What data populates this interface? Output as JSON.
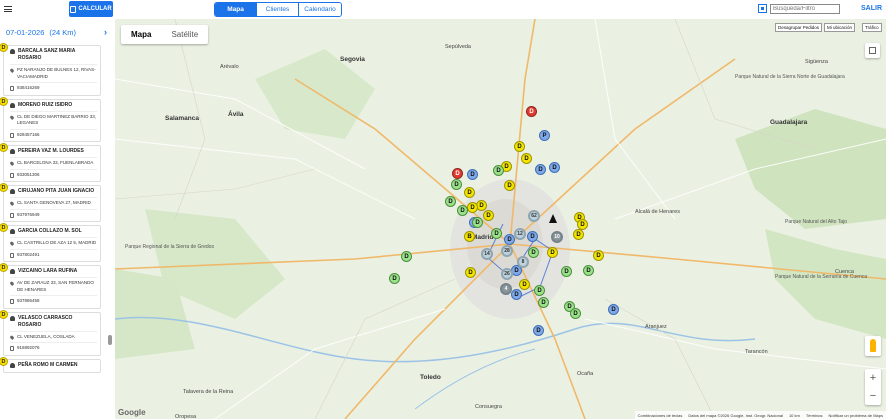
{
  "topbar": {
    "calc_label": "CALCULAR",
    "tabs": [
      "Mapa",
      "Clientes",
      "Calendario"
    ],
    "search_placeholder": "Búsqueda/Filtro",
    "logout_label": "SALIR"
  },
  "sidebar": {
    "date": "07-01-2026",
    "distance": "(24 Km)",
    "next_icon": "chevron-right-icon",
    "cards": [
      {
        "badge": "D",
        "name": "BARCALA SANZ MARIA ROSARIO",
        "address": "PZ NARANJO DE BULNES 12, RIVAS-VACIAMADRID",
        "phone": "938416269"
      },
      {
        "badge": "D",
        "name": "MORENO RUIZ ISIDRO",
        "address": "CL DE DIEGO MARTINEZ BARRIO 33, LEGANES",
        "phone": "928457166"
      },
      {
        "badge": "D",
        "name": "PEREIRA VAZ M. LOURDES",
        "address": "CL BARCELONA 33, FUENLABRADA",
        "phone": "933051306"
      },
      {
        "badge": "D",
        "name": "CIRUJANO PITA JUAN IGNACIO",
        "address": "CL SANTA GENOVEVA 27, MADRID",
        "phone": "937976949"
      },
      {
        "badge": "D",
        "name": "GARCIA COLLAZO M. SOL",
        "address": "CL CASTRILLO DE AZA 12 5, MADRID",
        "phone": "937802491"
      },
      {
        "badge": "D",
        "name": "VIZCAINO LARA RUFINA",
        "address": "AV DE ZARAUZ 33, SAN FERNANDO DE HENARES",
        "phone": "937886458"
      },
      {
        "badge": "D",
        "name": "VELASCO CARRASCO ROSARIO",
        "address": "CL VENEZUELA, COSLADA",
        "phone": "916892076"
      },
      {
        "badge": "D",
        "name": "PEÑA ROMO M CARMEN",
        "address": "",
        "phone": ""
      }
    ]
  },
  "map": {
    "types": [
      "Mapa",
      "Satélite"
    ],
    "buttons": [
      "Desagrupar Pedidos",
      "Mi ubicación",
      "Tráfico"
    ],
    "labels": [
      {
        "text": "Ávila",
        "cls": "big"
      },
      {
        "text": "Segovia",
        "cls": "big"
      },
      {
        "text": "Salamanca",
        "cls": "big"
      },
      {
        "text": "Madrid",
        "cls": "big"
      },
      {
        "text": "Guadalajara",
        "cls": "big"
      },
      {
        "text": "Toledo",
        "cls": "big"
      },
      {
        "text": "Talavera de la Reina",
        "cls": "city"
      },
      {
        "text": "Aranjuez",
        "cls": "city"
      },
      {
        "text": "Alcalá de Henares",
        "cls": "city"
      },
      {
        "text": "Arévalo",
        "cls": "city"
      },
      {
        "text": "Sepúlveda",
        "cls": "city"
      },
      {
        "text": "Cuenca",
        "cls": "city"
      },
      {
        "text": "Tarancón",
        "cls": "city"
      },
      {
        "text": "Ocaña",
        "cls": "city"
      },
      {
        "text": "Sigüenza",
        "cls": "city"
      },
      {
        "text": "Oropesa",
        "cls": "city"
      },
      {
        "text": "Consuegra",
        "cls": "city"
      },
      {
        "text": "Parque Natural de la Sierra Norte de Guadalajara",
        "cls": ""
      },
      {
        "text": "Parque Natural del Alto Tajo",
        "cls": ""
      },
      {
        "text": "Parque Regional de la Sierra de Gredos",
        "cls": ""
      },
      {
        "text": "Parque Natural de la Serranía de Cuenca",
        "cls": ""
      }
    ],
    "markers_letter": [
      "D",
      "D",
      "P",
      "D",
      "D",
      "D",
      "D",
      "B",
      "D",
      "D",
      "D",
      "D"
    ],
    "clusters": [
      "62",
      "12",
      "10",
      "14",
      "28",
      "26",
      "8",
      "4"
    ],
    "footer": [
      "Combinaciones de teclas",
      "Datos del mapa ©2026 Google, Inst. Geogr. Nacional",
      "10 km",
      "Términos",
      "Notificar un problema de Maps"
    ],
    "logo": "Google"
  }
}
